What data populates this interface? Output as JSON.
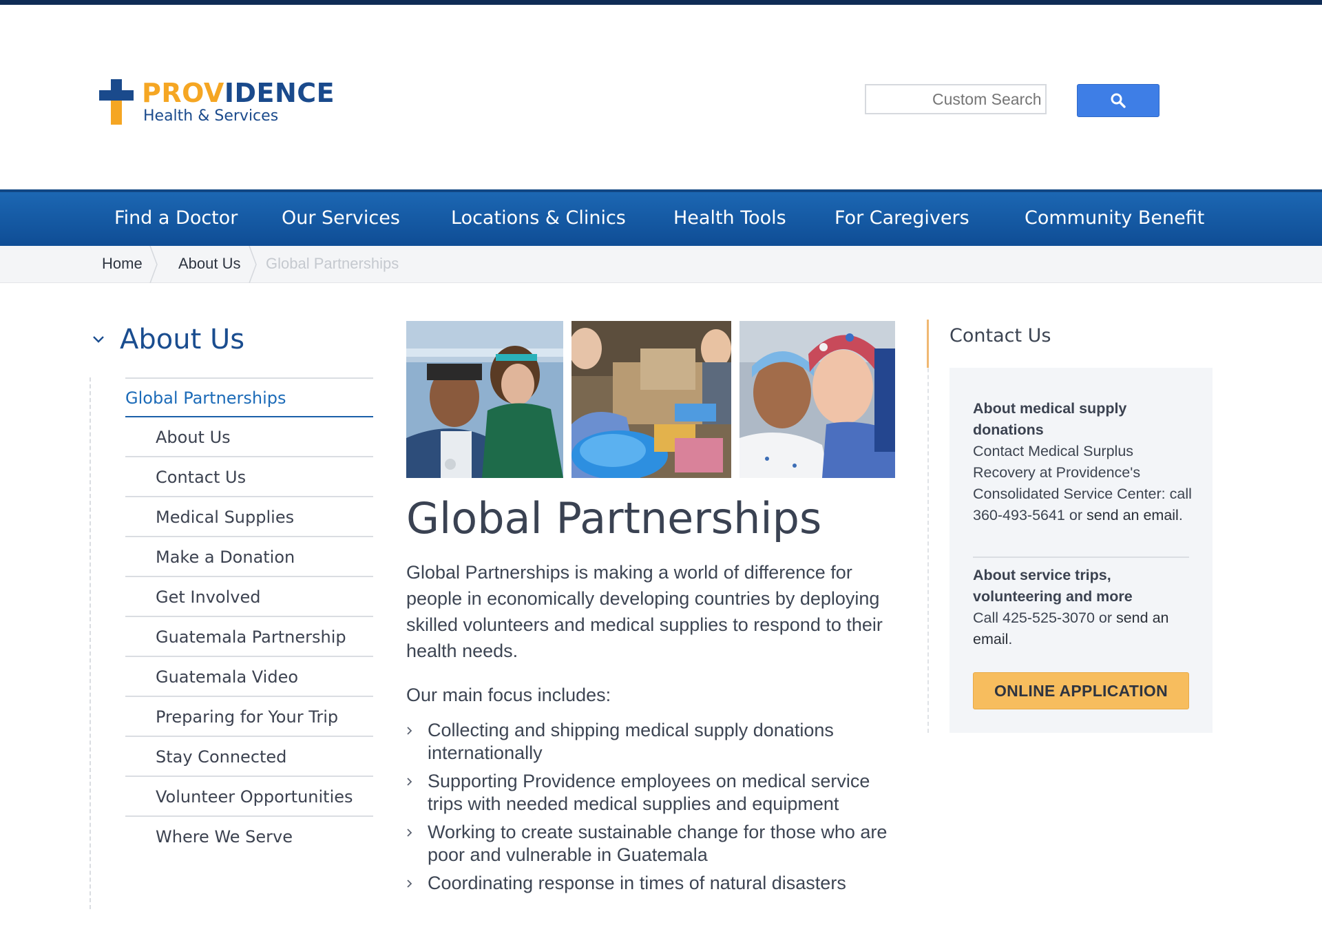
{
  "brand": {
    "name_part1": "PROV",
    "name_part2": "IDENCE",
    "subtitle": "Health & Services",
    "colors": {
      "orange": "#f5a623",
      "blue": "#1a4a8c"
    }
  },
  "search": {
    "placeholder": "Custom Search",
    "button_icon": "search-icon"
  },
  "nav": {
    "items": [
      "Find a Doctor",
      "Our Services",
      "Locations & Clinics",
      "Health Tools",
      "For Caregivers",
      "Community Benefit"
    ]
  },
  "breadcrumb": {
    "items": [
      "Home",
      "About Us",
      "Global Partnerships"
    ]
  },
  "sidebar": {
    "title": "About Us",
    "active": "Global Partnerships",
    "items": [
      "About Us",
      "Contact Us",
      "Medical Supplies",
      "Make a Donation",
      "Get Involved",
      "Guatemala Partnership",
      "Guatemala Video",
      "Preparing for Your Trip",
      "Stay Connected",
      "Volunteer Opportunities",
      "Where We Serve"
    ]
  },
  "main": {
    "title": "Global Partnerships",
    "intro": "Global Partnerships is making a world of difference for people in economically developing countries by deploying skilled volunteers and medical supplies to respond to their health needs.",
    "focus_heading": "Our main focus includes:",
    "bullets": [
      "Collecting and shipping medical supply donations internationally",
      "Supporting Providence employees on medical service trips with needed medical supplies and equipment",
      "Working to create sustainable change for those who are poor and vulnerable in Guatemala",
      "Coordinating response in times of natural disasters"
    ]
  },
  "contact": {
    "title": "Contact Us",
    "block1": {
      "heading": "About medical supply donations",
      "text": "Contact Medical Surplus Recovery at Providence's Consolidated Service Center: call 360-493-5641 or ",
      "link": "send an email",
      "end": "."
    },
    "block2": {
      "heading": "About service trips, volunteering and more",
      "text": "Call 425-525-3070 or ",
      "link": "send an email",
      "end": "."
    },
    "button": "ONLINE APPLICATION"
  }
}
